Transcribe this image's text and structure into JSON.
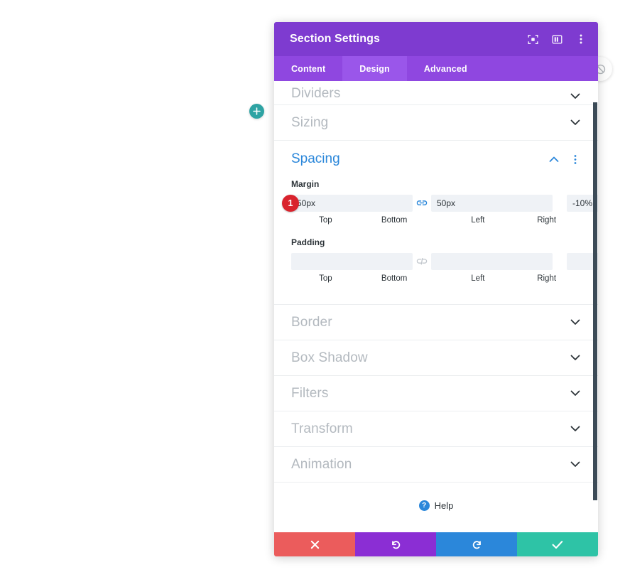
{
  "window": {
    "title": "Section Settings",
    "header_icons": [
      {
        "name": "focus-icon",
        "label": "Focus"
      },
      {
        "name": "layout-columns-icon",
        "label": "Layout"
      },
      {
        "name": "kebab-menu-icon",
        "label": "More options"
      }
    ]
  },
  "tabs": [
    {
      "label": "Content",
      "active": false
    },
    {
      "label": "Design",
      "active": true
    },
    {
      "label": "Advanced",
      "active": false
    }
  ],
  "sections_above": [
    {
      "label": "Dividers",
      "state": "collapsed"
    },
    {
      "label": "Sizing",
      "state": "collapsed"
    }
  ],
  "open_section": {
    "label": "Spacing",
    "state": "expanded",
    "groups": [
      {
        "label": "Margin",
        "link_left": {
          "name": "link-connected-icon",
          "linked": true
        },
        "link_right": {
          "name": "link-broken-icon",
          "linked": false
        },
        "fields": [
          {
            "sub": "Top",
            "value": "50px",
            "placeholder": ""
          },
          {
            "sub": "Bottom",
            "value": "50px",
            "placeholder": ""
          },
          {
            "sub": "Left",
            "value": "-10%",
            "placeholder": ""
          },
          {
            "sub": "Right",
            "value": "-10%",
            "placeholder": ""
          }
        ],
        "badge": "1"
      },
      {
        "label": "Padding",
        "link_left": {
          "name": "link-broken-icon",
          "linked": false
        },
        "link_right": {
          "name": "link-broken-icon",
          "linked": false
        },
        "fields": [
          {
            "sub": "Top",
            "value": "",
            "placeholder": ""
          },
          {
            "sub": "Bottom",
            "value": "",
            "placeholder": ""
          },
          {
            "sub": "Left",
            "value": "",
            "placeholder": ""
          },
          {
            "sub": "Right",
            "value": "",
            "placeholder": ""
          }
        ],
        "badge": ""
      }
    ]
  },
  "sections_below": [
    {
      "label": "Border",
      "state": "collapsed"
    },
    {
      "label": "Box Shadow",
      "state": "collapsed"
    },
    {
      "label": "Filters",
      "state": "collapsed"
    },
    {
      "label": "Transform",
      "state": "collapsed"
    },
    {
      "label": "Animation",
      "state": "collapsed"
    }
  ],
  "help": {
    "label": "Help",
    "icon": "question-mark-icon",
    "glyph": "?"
  },
  "footer_buttons": [
    {
      "name": "cancel-button",
      "icon": "close-x-icon",
      "color": "#eb5c5c"
    },
    {
      "name": "undo-button",
      "icon": "undo-arrow-icon",
      "color": "#8b2ed4"
    },
    {
      "name": "redo-button",
      "icon": "redo-arrow-icon",
      "color": "#2b87da"
    },
    {
      "name": "save-button",
      "icon": "checkmark-icon",
      "color": "#2ec3a6"
    }
  ],
  "canvas": {
    "add_section_button": {
      "name": "add-section-button",
      "glyph": "+",
      "color": "#2ea3a3"
    },
    "edge_handle": {
      "name": "disable-toggle-handle",
      "icon": "circle-slash-icon"
    }
  },
  "colors": {
    "header_purple": "#7e3bd0",
    "tabs_purple": "#8f47e0",
    "tab_active_purple": "#9a56ea",
    "accent_blue": "#2b87da",
    "section_grey": "#b3b9bf",
    "input_bg": "#eff2f6",
    "badge_red": "#d9232d",
    "scrollbar": "#3c4b57"
  }
}
